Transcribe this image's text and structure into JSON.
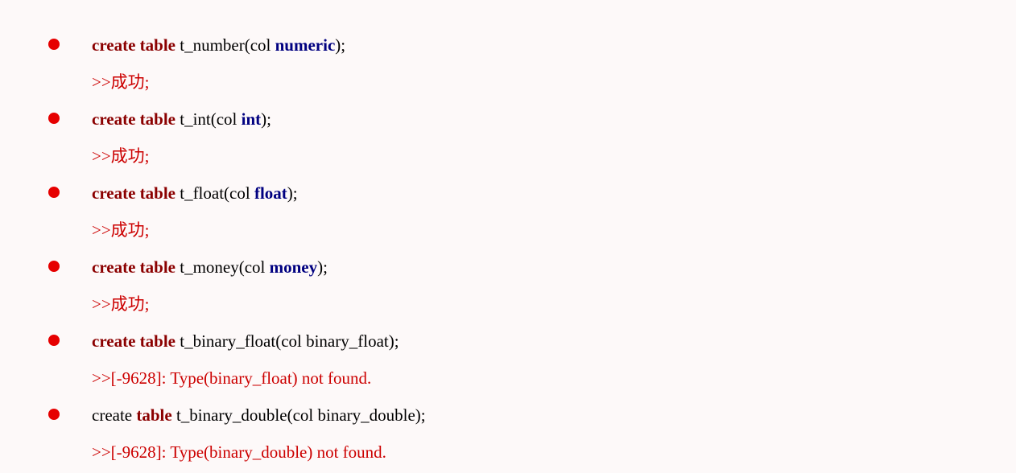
{
  "items": [
    {
      "sql": {
        "p1_kw": "create table",
        "p2_plain": " t_number(col ",
        "p3_type": "numeric",
        "p4_plain": ");"
      },
      "result": ">>成功;"
    },
    {
      "sql": {
        "p1_kw": "create table",
        "p2_plain": " t_int(col ",
        "p3_type": "int",
        "p4_plain": ");"
      },
      "result": ">>成功;"
    },
    {
      "sql": {
        "p1_kw": "create table",
        "p2_plain": " t_float(col ",
        "p3_type": "float",
        "p4_plain": ");"
      },
      "result": ">>成功;"
    },
    {
      "sql": {
        "p1_kw": "create table",
        "p2_plain": " t_money(col ",
        "p3_type": "money",
        "p4_plain": ");"
      },
      "result": ">>成功;"
    },
    {
      "sql": {
        "p1_kw": "create table",
        "p2_plain": " t_binary_float(col binary_float);",
        "p3_type": "",
        "p4_plain": ""
      },
      "result": ">>[-9628]:   Type(binary_float) not found."
    },
    {
      "sql": {
        "p1_plain_lead": "create ",
        "p1_kw": "table",
        "p2_plain": " t_binary_double(col binary_double);",
        "p3_type": "",
        "p4_plain": ""
      },
      "result": ">>[-9628]:   Type(binary_double) not found."
    }
  ]
}
